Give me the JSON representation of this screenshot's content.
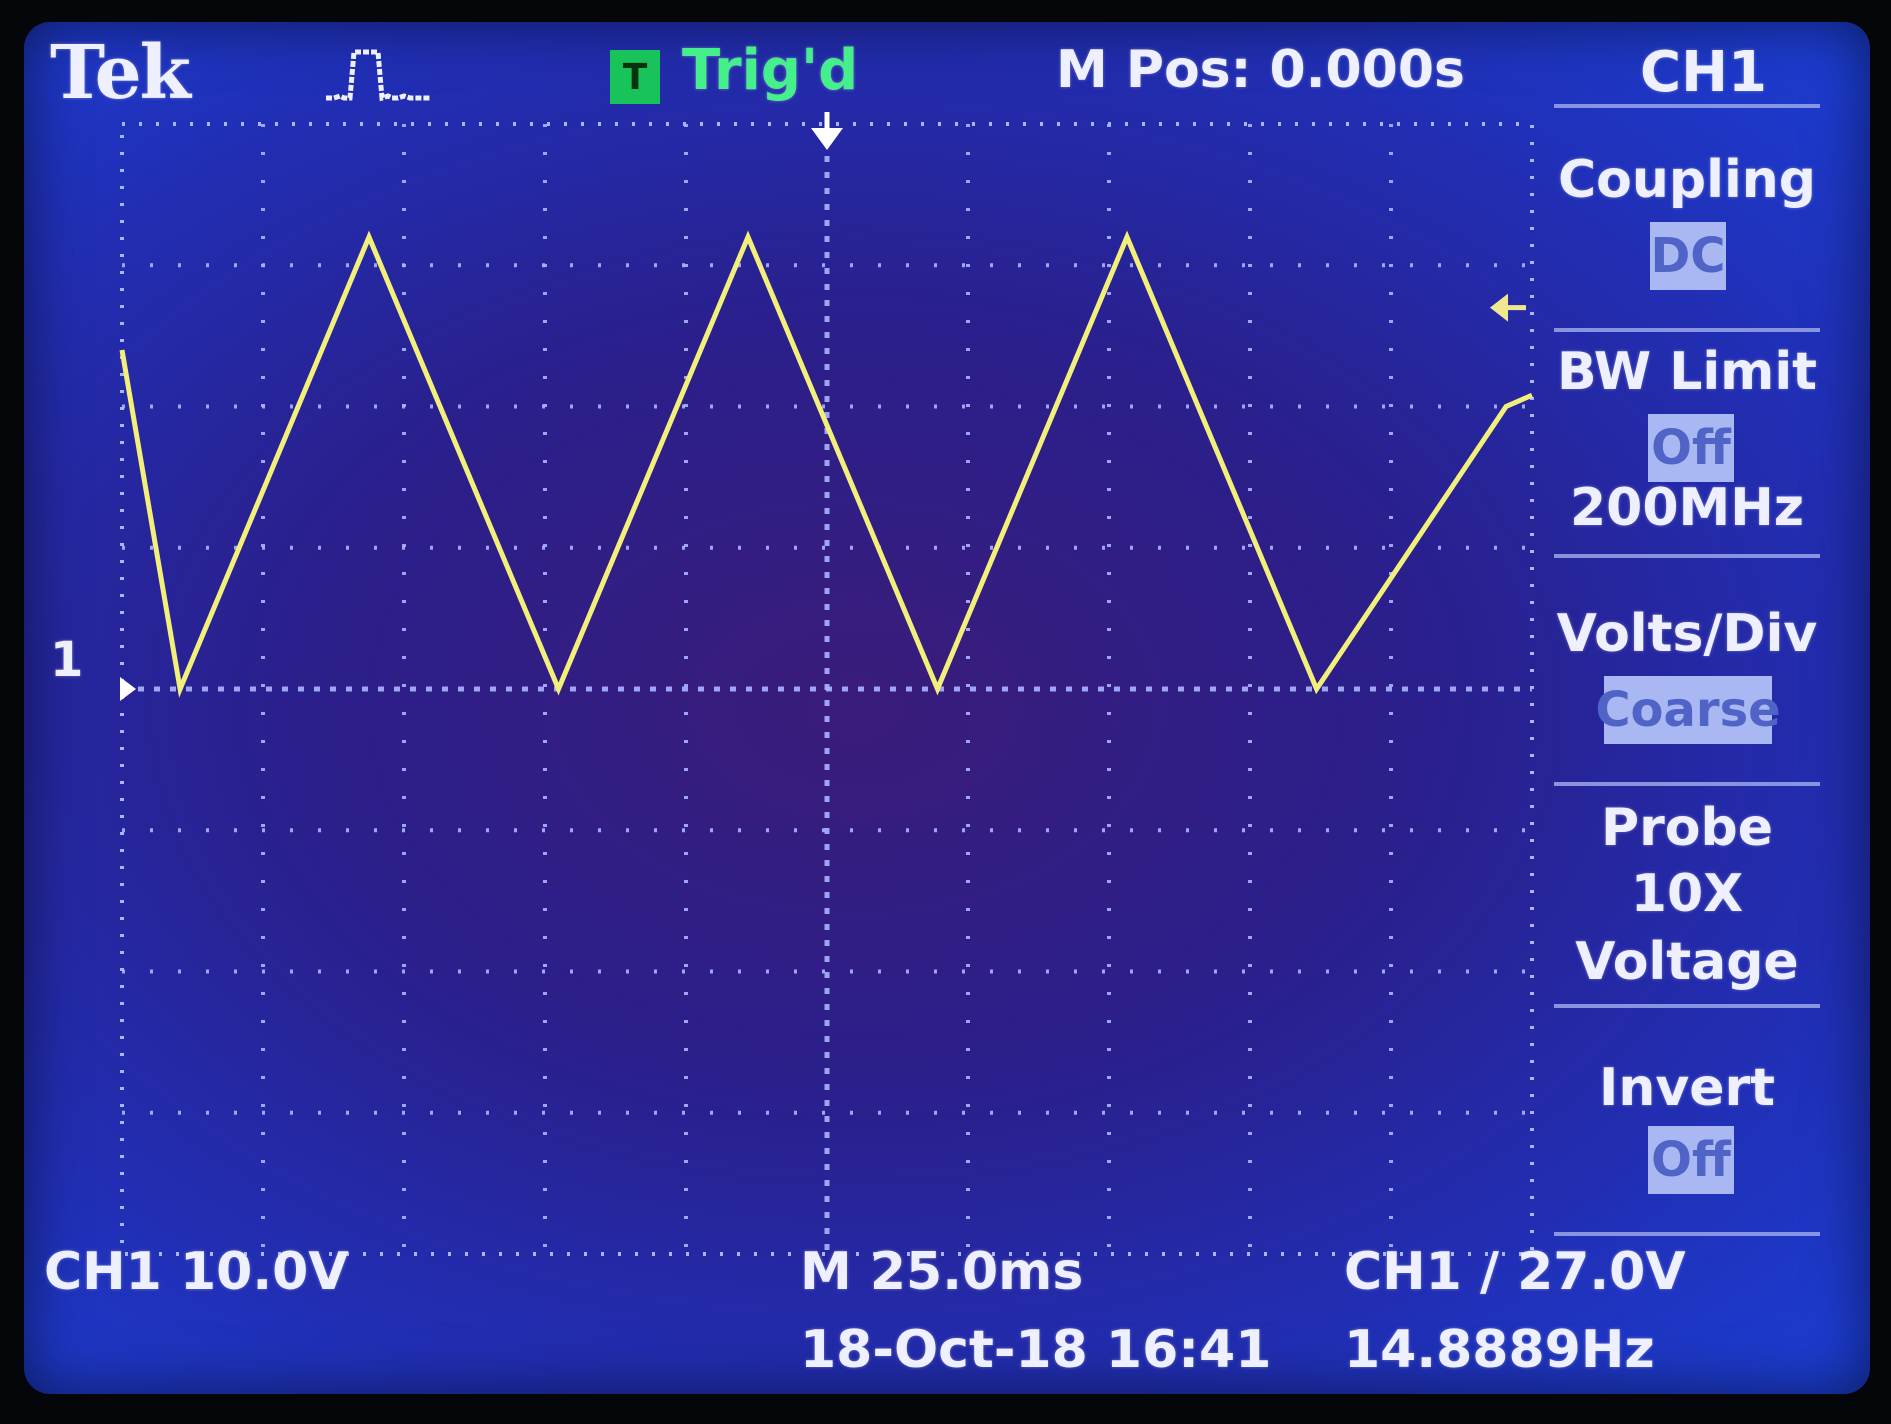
{
  "header": {
    "brand": "Tek",
    "trigger_badge": "T",
    "trigger_status": "Trig'd",
    "main_position": "M Pos: 0.000s",
    "channel": "CH1"
  },
  "menu": {
    "coupling": {
      "label": "Coupling",
      "value": "DC"
    },
    "bw_limit": {
      "label": "BW Limit",
      "value": "Off",
      "sub": "200MHz"
    },
    "volts_div": {
      "label": "Volts/Div",
      "value": "Coarse"
    },
    "probe": {
      "label": "Probe",
      "value": "10X",
      "sub": "Voltage"
    },
    "invert": {
      "label": "Invert",
      "value": "Off"
    }
  },
  "footer": {
    "ch_scale": "CH1  10.0V",
    "timebase": "M 25.0ms",
    "trigger": "CH1 ∕ 27.0V",
    "datetime": "18-Oct-18 16:41",
    "frequency": "14.8889Hz"
  },
  "markers": {
    "ground_label": "1"
  },
  "colors": {
    "trace": "#f3f07a",
    "grid": "#aab4ff",
    "trig_badge": "#18c35a",
    "trig_text": "#45f08c"
  },
  "chart_data": {
    "type": "line",
    "divisions_x": 10,
    "divisions_y": 8,
    "volts_per_div": 10.0,
    "time_per_div_ms": 25.0,
    "trigger_level_v": 27.0,
    "frequency_hz": 14.8889,
    "series": [
      {
        "x": [
          -125,
          -114.7,
          -81.2,
          -47.6,
          -14.0,
          19.6,
          53.2,
          86.8,
          120.4,
          125
        ],
        "values": [
          24,
          0,
          32,
          0,
          32,
          0,
          32,
          0,
          20,
          20.8
        ]
      }
    ]
  }
}
